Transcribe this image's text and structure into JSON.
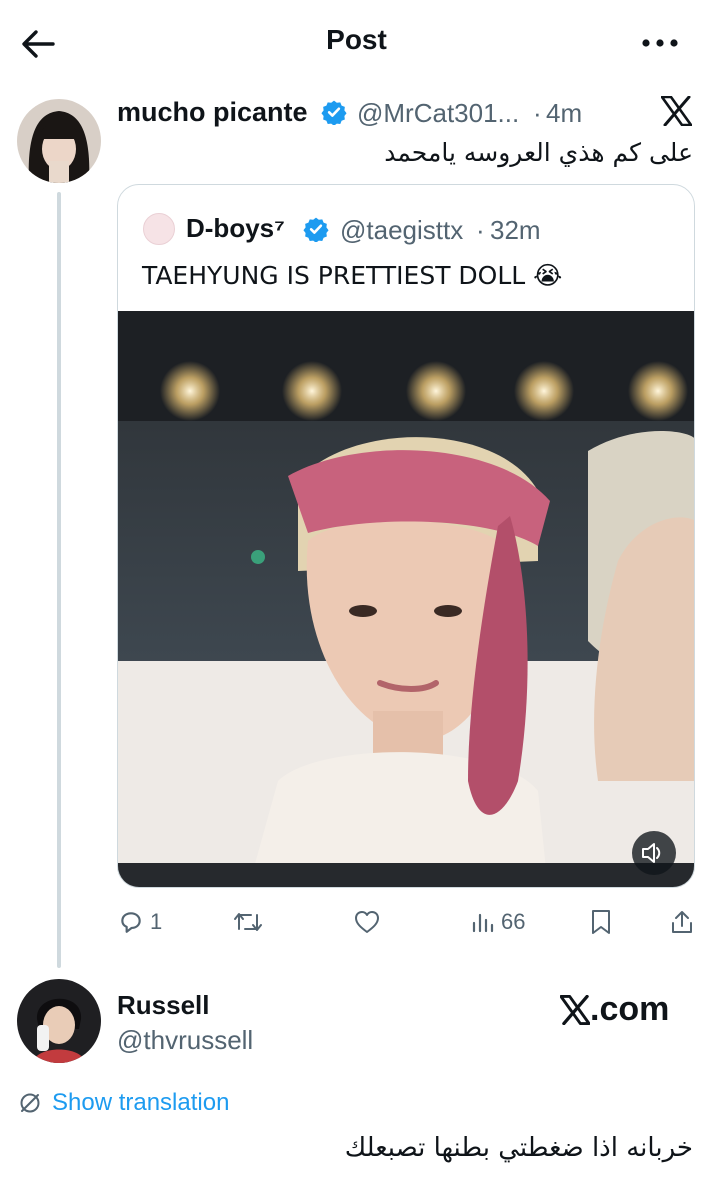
{
  "header": {
    "title": "Post"
  },
  "tweet": {
    "display_name": "mucho picante",
    "handle": "@MrCat301...",
    "separator": "·",
    "time": "4m",
    "text": "على كم هذي العروسه يامحمد"
  },
  "quote": {
    "display_name": "D-boys⁷",
    "handle": "@taegisttx",
    "separator": "·",
    "time": "32m",
    "text": "TAEHYUNG IS PRETTIEST DOLL 😭"
  },
  "actions": {
    "reply_count": "1",
    "repost_count": "",
    "like_count": "",
    "views_count": "66"
  },
  "reply": {
    "display_name": "Russell",
    "handle": "@thvrussell",
    "translate_label": "Show translation",
    "text": "خربانه اذا ضغطتي بطنها تصبعلك"
  },
  "watermark": {
    "text": ".com"
  },
  "icons": {
    "back": "back-arrow-icon",
    "more": "more-dots-icon",
    "logo": "x-logo-icon",
    "verified": "verified-badge-icon",
    "sound": "speaker-muted-icon",
    "reply": "reply-icon",
    "repost": "repost-icon",
    "like": "heart-icon",
    "views": "views-icon",
    "bookmark": "bookmark-icon",
    "share": "share-icon",
    "translate": "translate-icon"
  },
  "colors": {
    "accent": "#1d9bf0",
    "text": "#0f1419",
    "muted": "#536471",
    "border": "#cfd9de"
  }
}
